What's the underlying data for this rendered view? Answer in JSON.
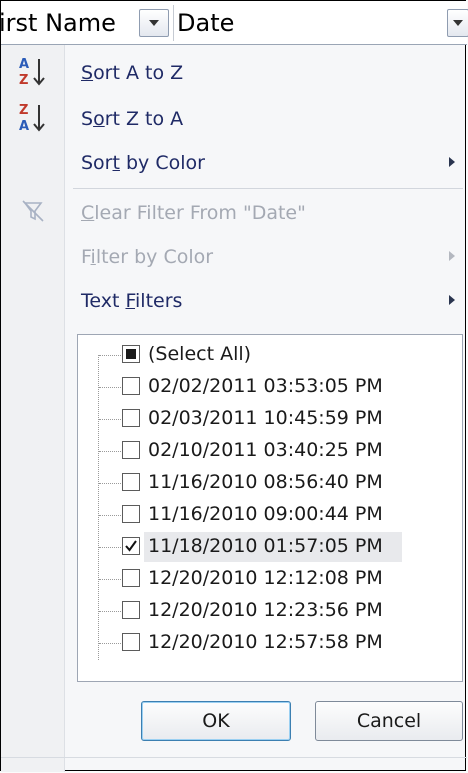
{
  "header": {
    "column_first": "irst Name",
    "column_date": "Date"
  },
  "menu": {
    "sort_az": {
      "pre": "",
      "u": "S",
      "post": "ort A to Z"
    },
    "sort_za": {
      "pre": "S",
      "u": "o",
      "post": "rt Z to A"
    },
    "sort_color": {
      "pre": "Sor",
      "u": "t",
      "post": " by Color"
    },
    "clear_filter": {
      "pre": "",
      "u": "C",
      "post": "lear Filter From \"Date\""
    },
    "filter_color": {
      "pre": "F",
      "u": "i",
      "post": "lter by Color"
    },
    "text_filters": {
      "pre": "Text ",
      "u": "F",
      "post": "ilters"
    }
  },
  "list": {
    "select_all": "(Select All)",
    "items": [
      {
        "label": "02/02/2011 03:53:05 PM",
        "checked": false
      },
      {
        "label": "02/03/2011 10:45:59 PM",
        "checked": false
      },
      {
        "label": "02/10/2011 03:40:25 PM",
        "checked": false
      },
      {
        "label": "11/16/2010 08:56:40 PM",
        "checked": false
      },
      {
        "label": "11/16/2010 09:00:44 PM",
        "checked": false
      },
      {
        "label": "11/18/2010 01:57:05 PM",
        "checked": true
      },
      {
        "label": "12/20/2010 12:12:08 PM",
        "checked": false
      },
      {
        "label": "12/20/2010 12:23:56 PM",
        "checked": false
      },
      {
        "label": "12/20/2010 12:57:58 PM",
        "checked": false
      }
    ]
  },
  "buttons": {
    "ok": "OK",
    "cancel": "Cancel"
  },
  "icons": {
    "sort_az": "sort-ascending-icon",
    "sort_za": "sort-descending-icon",
    "clear_filter": "clear-filter-icon",
    "dropdown": "chevron-down-icon"
  },
  "colors": {
    "menu_text": "#1f2a66",
    "disabled_text": "#a4a9b3",
    "ok_border": "#3c7fb1"
  }
}
